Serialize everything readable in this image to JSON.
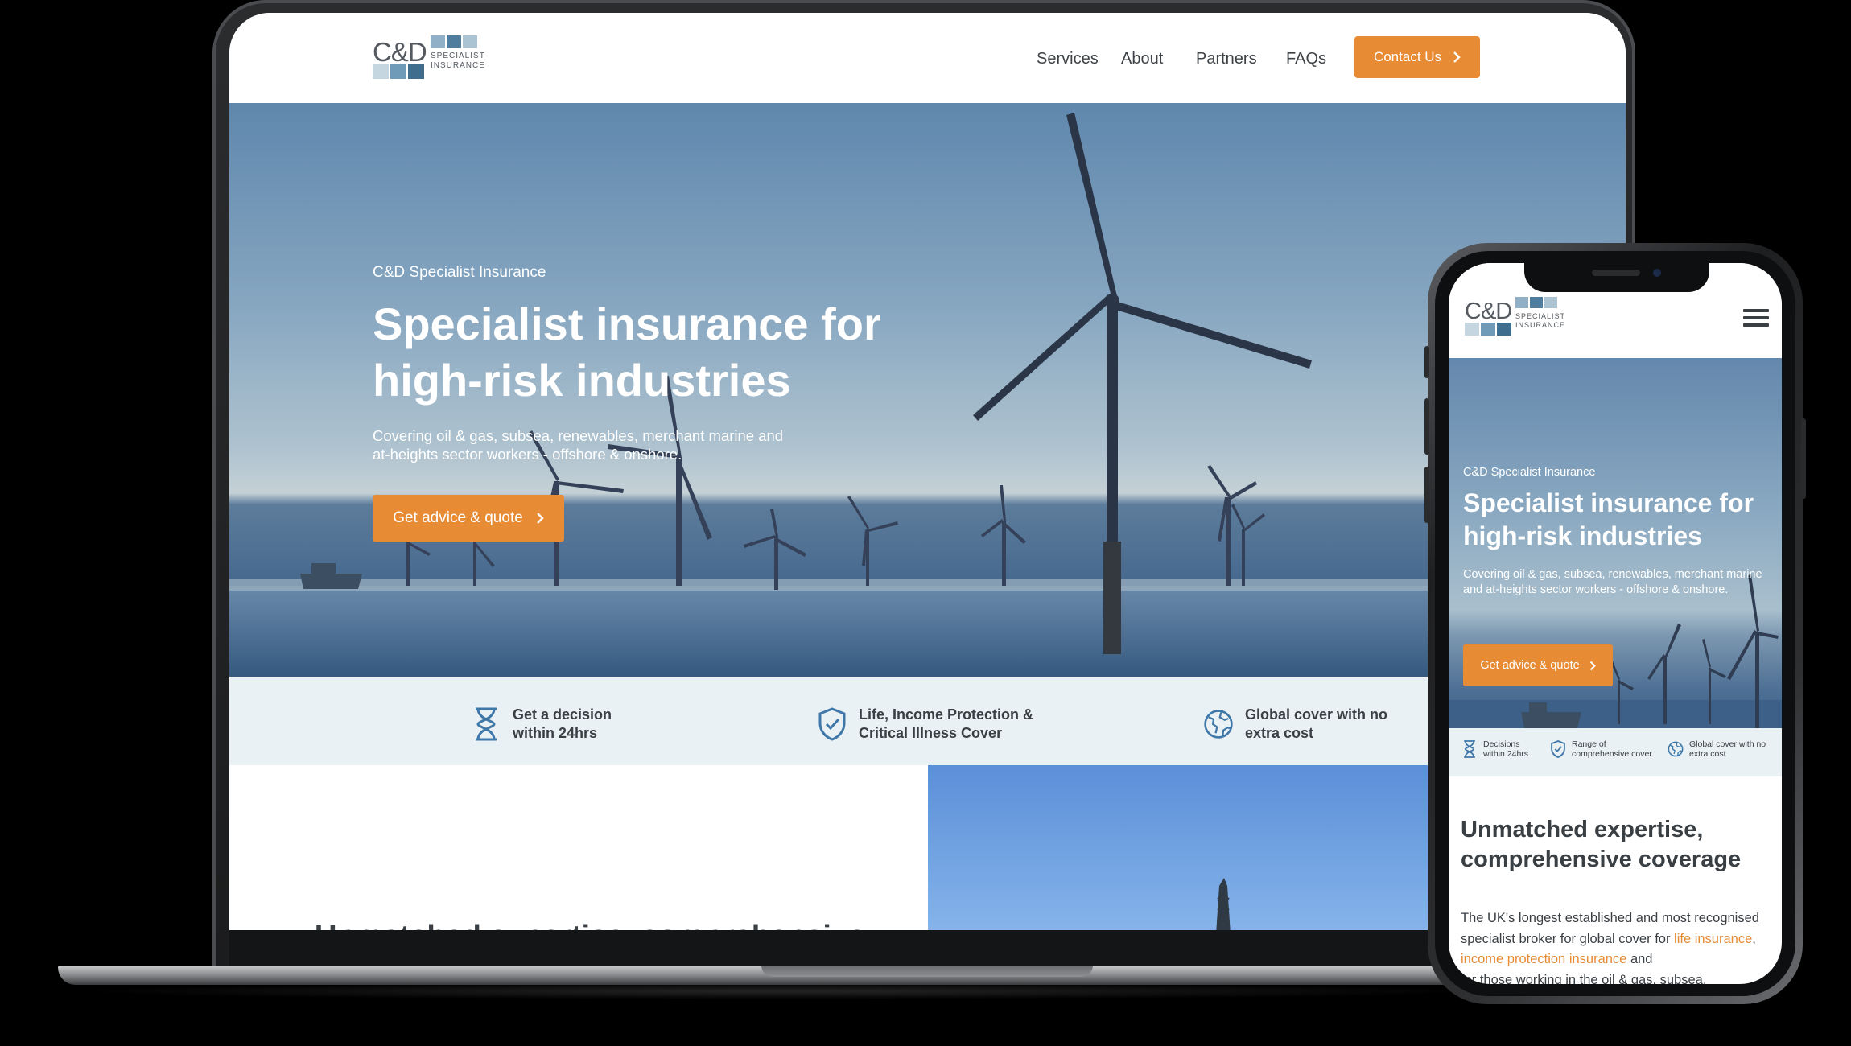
{
  "brand": {
    "logo_text": "C&D",
    "logo_sub_line1": "SPECIALIST",
    "logo_sub_line2": "INSURANCE",
    "tile_colors": [
      "#8fb0c6",
      "#4f7d9e",
      "#aac4d4",
      "#c5d6e0",
      "#6f9bb8",
      "#3f6d8e"
    ]
  },
  "colors": {
    "accent": "#e88b35",
    "text_dark": "#3a3f44",
    "feature_strip": "#e9f1f4",
    "icon_blue": "#3f78a8"
  },
  "desktop": {
    "nav": {
      "items": [
        "Services",
        "About",
        "Partners",
        "FAQs"
      ],
      "contact_label": "Contact Us"
    },
    "hero": {
      "eyebrow": "C&D Specialist Insurance",
      "title_line1": "Specialist insurance for",
      "title_line2": "high-risk industries",
      "description_line1": "Covering oil & gas, subsea, renewables, merchant marine and",
      "description_line2": "at-heights sector workers - offshore & onshore.",
      "cta_label": "Get advice & quote"
    },
    "features": [
      {
        "icon": "hourglass-icon",
        "line1": "Get a decision",
        "line2": "within 24hrs"
      },
      {
        "icon": "shield-check-icon",
        "line1": "Life, Income Protection &",
        "line2": "Critical Illness Cover"
      },
      {
        "icon": "globe-icon",
        "line1": "Global cover with no",
        "line2": "extra cost"
      }
    ],
    "section_title": "Unmatched expertise, comprehensive"
  },
  "mobile": {
    "hero": {
      "eyebrow": "C&D Specialist Insurance",
      "title_line1": "Specialist insurance for",
      "title_line2": "high-risk industries",
      "description": "Covering oil & gas, subsea, renewables, merchant marine and at-heights sector workers - offshore & onshore.",
      "cta_label": "Get advice & quote"
    },
    "features": [
      {
        "icon": "hourglass-icon",
        "line1": "Decisions",
        "line2": "within 24hrs"
      },
      {
        "icon": "shield-check-icon",
        "line1": "Range of",
        "line2": "comprehensive cover"
      },
      {
        "icon": "globe-icon",
        "line1": "Global cover with no",
        "line2": "extra cost"
      }
    ],
    "section_title": "Unmatched expertise, comprehensive coverage",
    "body_text_start": "The UK's longest established and most recognised specialist broker for global cover for ",
    "link1": "life insurance",
    "sep": ", ",
    "link2": "income protection insurance",
    "body_text_end": " and",
    "body_text_line4": "for those working in the oil & gas, subsea,"
  }
}
